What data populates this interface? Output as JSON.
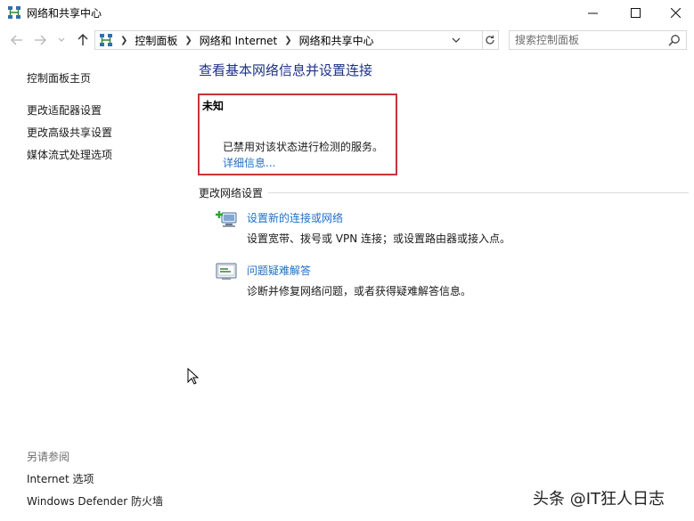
{
  "window": {
    "title": "网络和共享中心",
    "icon": "network-icon",
    "controls": [
      "minimize-icon",
      "maximize-icon",
      "close-icon"
    ]
  },
  "address": {
    "breadcrumbs": [
      "控制面板",
      "网络和 Internet",
      "网络和共享中心"
    ],
    "search_placeholder": "搜索控制面板"
  },
  "left_pane": {
    "home": "控制面板主页",
    "links": [
      "更改适配器设置",
      "更改高级共享设置",
      "媒体流式处理选项"
    ],
    "see_also_title": "另请参阅",
    "see_also": [
      "Internet 选项",
      "Windows Defender 防火墙"
    ]
  },
  "main": {
    "title": "查看基本网络信息并设置连接",
    "network": {
      "name": "未知",
      "status": "已禁用对该状态进行检测的服务。",
      "details_link": "详细信息..."
    },
    "change_settings_heading": "更改网络设置",
    "tasks": [
      {
        "link": "设置新的连接或网络",
        "desc": "设置宽带、拨号或 VPN 连接；或设置路由器或接入点。",
        "icon": "new-connection-icon"
      },
      {
        "link": "问题疑难解答",
        "desc": "诊断并修复网络问题，或者获得疑难解答信息。",
        "icon": "troubleshoot-icon"
      }
    ]
  },
  "watermark": "头条 @IT狂人日志",
  "colors": {
    "accent_link": "#1f6fc5",
    "title_blue": "#1e3287",
    "highlight_red": "#c8323a"
  }
}
